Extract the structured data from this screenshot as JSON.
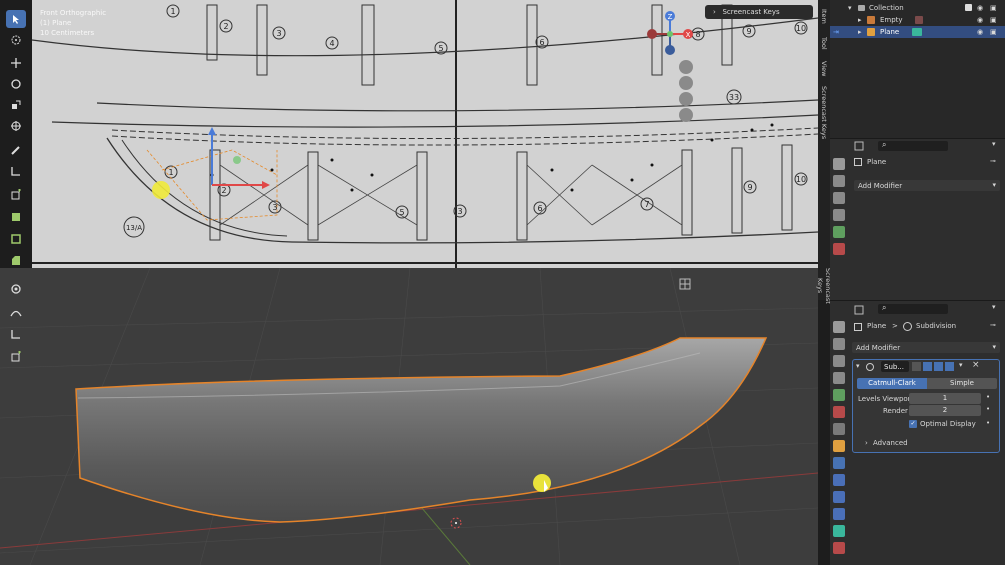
{
  "viewport_info": {
    "view_name": "Front Orthographic",
    "object": "(1) Plane",
    "units": "10 Centimeters"
  },
  "screencast_panel": {
    "label": "Screencast Keys"
  },
  "side_tabs": [
    "Item",
    "Tool",
    "View",
    "Screencast Keys"
  ],
  "side_tab_lower": "Screencast Keys",
  "outliner": {
    "collection": "Collection",
    "items": [
      {
        "name": "Empty",
        "selected": false
      },
      {
        "name": "Plane",
        "selected": true
      }
    ]
  },
  "properties_top": {
    "object_name": "Plane",
    "add_modifier": "Add Modifier"
  },
  "properties_bottom": {
    "object_name": "Plane",
    "breadcrumb_sep": ">",
    "modifier_name": "Subdivision",
    "add_modifier": "Add Modifier",
    "modifier_short": "Sub...",
    "close": "×",
    "algorithms": [
      "Catmull-Clark",
      "Simple"
    ],
    "levels_viewport_label": "Levels Viewport",
    "levels_viewport_value": "1",
    "render_label": "Render",
    "render_value": "2",
    "optimal_display_label": "Optimal Display",
    "advanced_label": "Advanced"
  },
  "blueprint_labels": [
    "1",
    "2",
    "3",
    "4",
    "5",
    "6",
    "7",
    "8",
    "9",
    "10",
    "33",
    "13/A"
  ],
  "gizmo": {
    "z": "Z",
    "y": "Y",
    "x": "X"
  },
  "colors": {
    "accent": "#4772b3",
    "selection_outline": "#e5842a",
    "viewport_bg": "#3d3d3d",
    "panel_bg": "#2b2b2b"
  }
}
